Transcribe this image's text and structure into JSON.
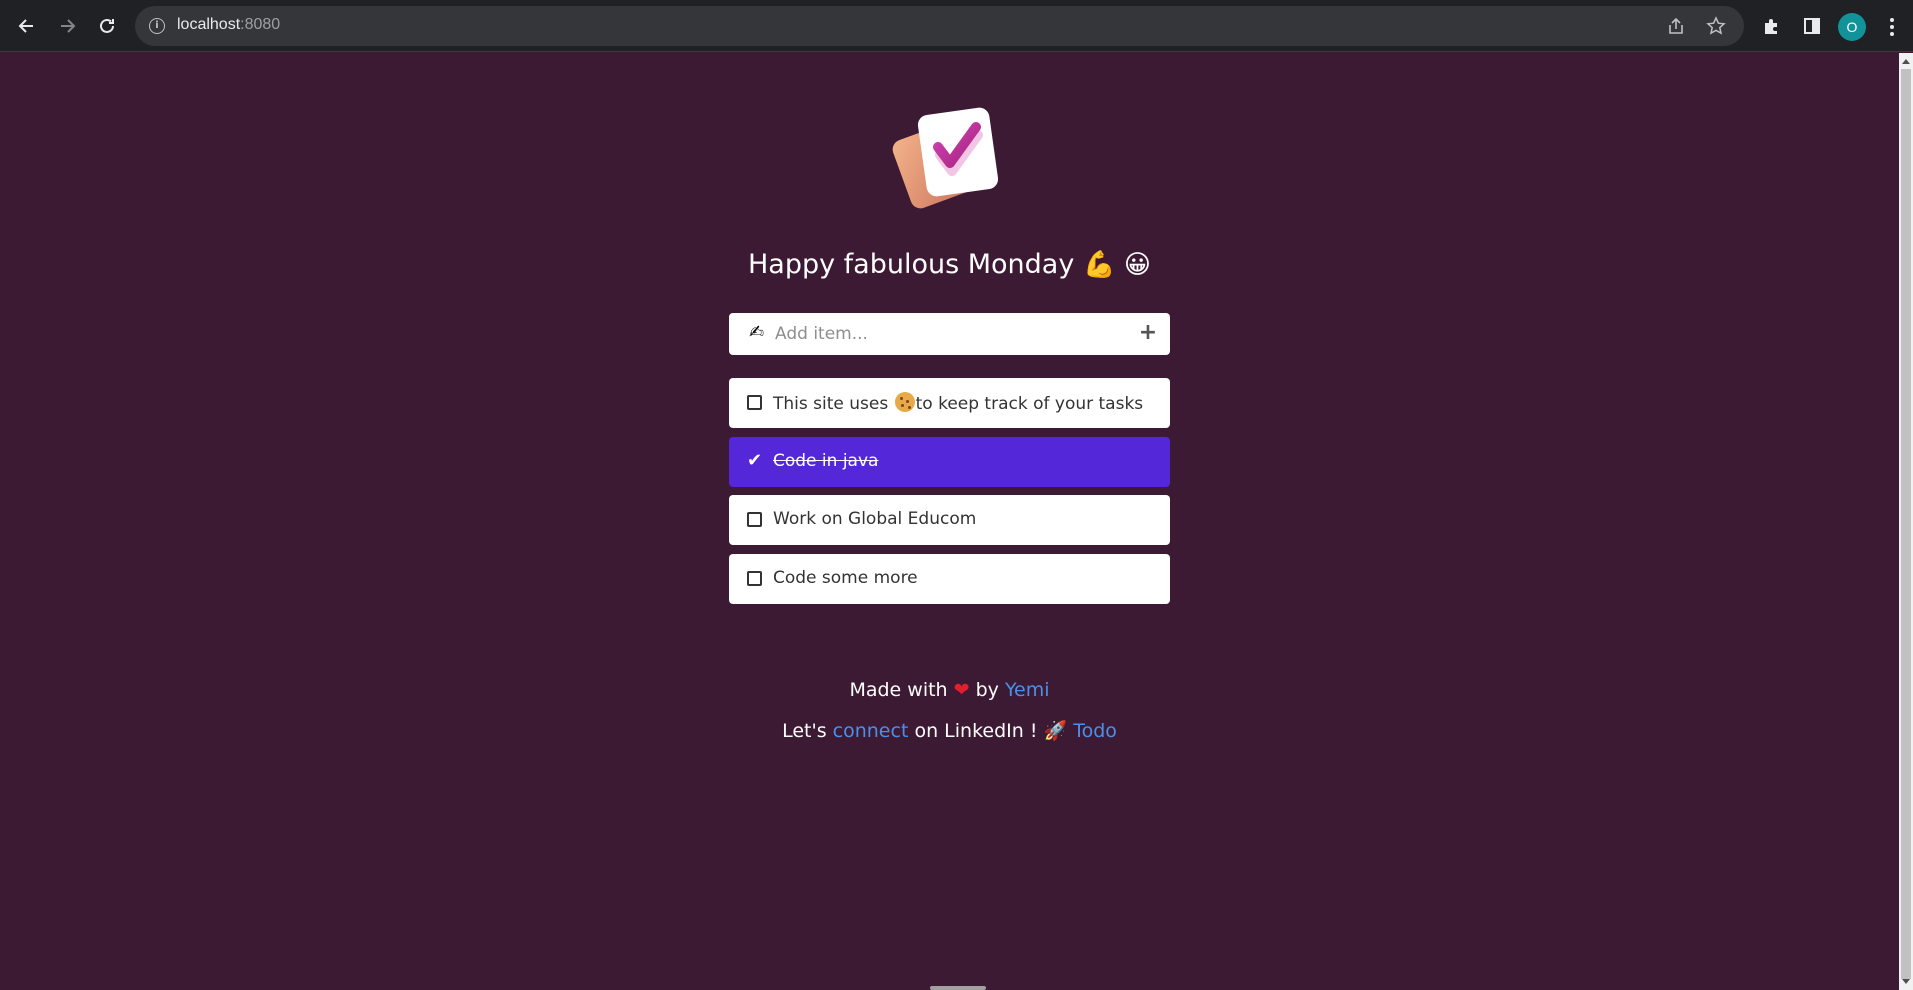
{
  "browser": {
    "url_host": "localhost",
    "url_port": ":8080",
    "profile_initial": "O"
  },
  "app": {
    "greeting_text": "Happy fabulous Monday",
    "greeting_emoji_1": "💪",
    "greeting_emoji_2": "😀",
    "add_placeholder": "Add item...",
    "add_icon": "✍",
    "todos": [
      {
        "pre": "This site uses",
        "post": "to keep track of your tasks",
        "has_cookie": true,
        "done": false
      },
      {
        "text": "Code in java",
        "done": true
      },
      {
        "text": "Work on Global Educom",
        "done": false
      },
      {
        "text": "Code some more",
        "done": false
      }
    ],
    "footer": {
      "made_with": "Made with",
      "by": "by",
      "author": "Yemi",
      "lets": "Let's",
      "connect": "connect",
      "on_linkedin": "on LinkedIn !",
      "rocket": "🚀",
      "todo_link": "Todo"
    }
  },
  "colors": {
    "background": "#3c1a33",
    "done_item": "#5427d8",
    "link": "#4d8fe8"
  }
}
